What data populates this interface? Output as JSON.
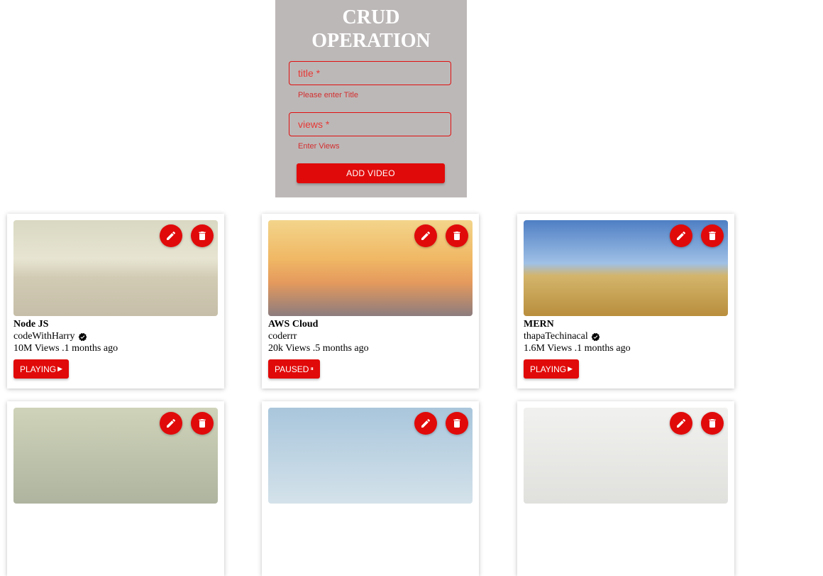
{
  "form": {
    "title_line1": "CRUD",
    "title_line2": "OPERATION",
    "title_placeholder": "title *",
    "title_helper": "Please enter Title",
    "views_placeholder": "views *",
    "views_helper": "Enter Views",
    "submit_label": "ADD VIDEO"
  },
  "colors": {
    "accent": "#e10a0a",
    "panel": "#bdb8b8"
  },
  "videos": [
    {
      "title": "Node JS",
      "channel": "codeWithHarry",
      "verified": true,
      "views": "10M Views",
      "time": ".1 months ago",
      "status": "PLAYING",
      "status_icon": "play-icon"
    },
    {
      "title": "AWS Cloud",
      "channel": "coderrr",
      "verified": false,
      "views": "20k Views",
      "time": ".5 months ago",
      "status": "PAUSED",
      "status_icon": "pause-icon"
    },
    {
      "title": "MERN",
      "channel": "thapaTechinacal",
      "verified": true,
      "views": "1.6M Views",
      "time": ".1 months ago",
      "status": "PLAYING",
      "status_icon": "play-icon"
    }
  ]
}
